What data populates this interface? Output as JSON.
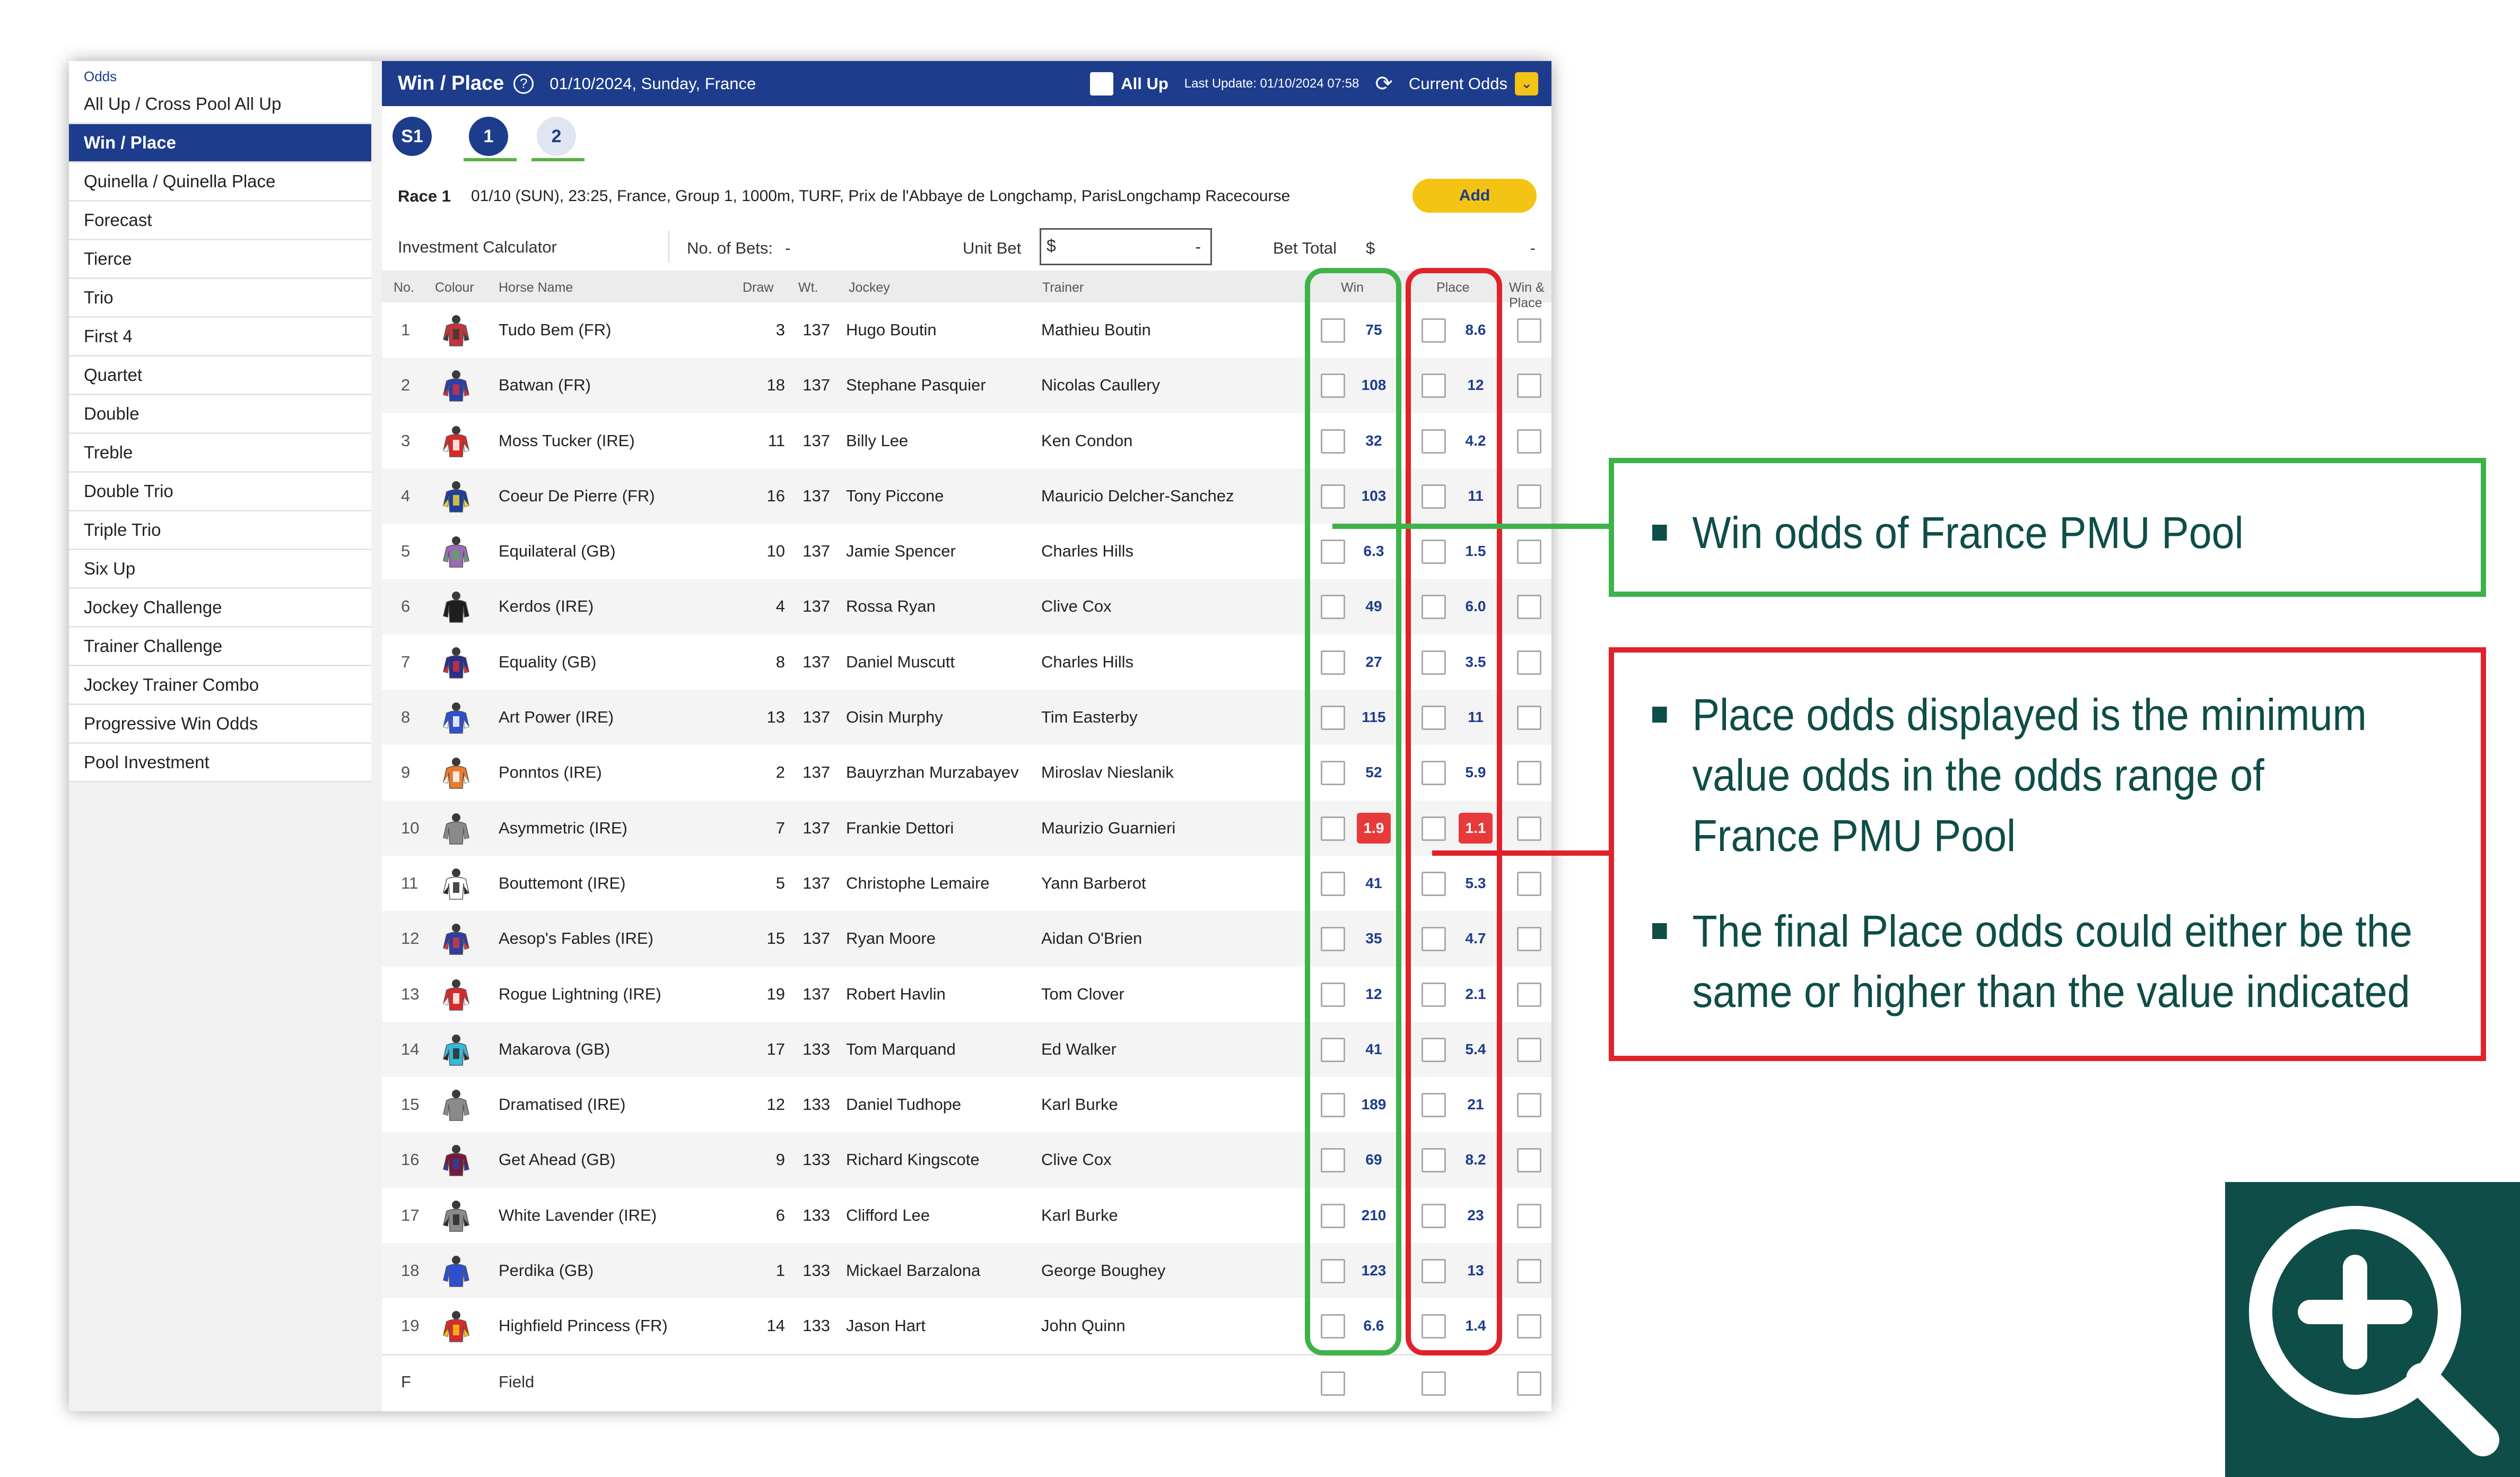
{
  "sidebar": {
    "header": "Odds",
    "items": [
      {
        "label": "All Up / Cross Pool All Up"
      },
      {
        "label": "Win / Place"
      },
      {
        "label": "Quinella / Quinella Place"
      },
      {
        "label": "Forecast"
      },
      {
        "label": "Tierce"
      },
      {
        "label": "Trio"
      },
      {
        "label": "First 4"
      },
      {
        "label": "Quartet"
      },
      {
        "label": "Double"
      },
      {
        "label": "Treble"
      },
      {
        "label": "Double Trio"
      },
      {
        "label": "Triple Trio"
      },
      {
        "label": "Six Up"
      },
      {
        "label": "Jockey Challenge"
      },
      {
        "label": "Trainer Challenge"
      },
      {
        "label": "Jockey Trainer Combo"
      },
      {
        "label": "Progressive Win Odds"
      },
      {
        "label": "Pool Investment"
      }
    ]
  },
  "topbar": {
    "title": "Win / Place",
    "help_icon": "?",
    "meeting": "01/10/2024, Sunday, France",
    "all_up": "All Up",
    "last_update": "Last Update: 01/10/2024 07:58",
    "refresh_icon": "⟳",
    "odds_type": "Current Odds",
    "chevron": "⌄"
  },
  "race_tabs": [
    "S1",
    "1",
    "2"
  ],
  "race": {
    "label": "Race 1",
    "description": "01/10 (SUN), 23:25, France, Group 1, 1000m, TURF, Prix de l'Abbaye de Longchamp, ParisLongchamp Racecourse",
    "add_label": "Add"
  },
  "calculator": {
    "title": "Investment Calculator",
    "no_of_bets_label": "No. of Bets:",
    "no_of_bets_value": "-",
    "unit_bet_label": "Unit Bet",
    "unit_bet_prefix": "$",
    "unit_bet_value": "-",
    "bet_total_label": "Bet Total",
    "bet_total_prefix": "$",
    "bet_total_value": "-"
  },
  "columns": {
    "no": "No.",
    "colour": "Colour",
    "horse": "Horse Name",
    "draw": "Draw",
    "wt": "Wt.",
    "jockey": "Jockey",
    "trainer": "Trainer",
    "win": "Win",
    "place": "Place",
    "win_place": "Win & Place"
  },
  "runners": [
    {
      "no": "1",
      "horse": "Tudo Bem (FR)",
      "draw": "3",
      "wt": "137",
      "jockey": "Hugo Boutin",
      "trainer": "Mathieu Boutin",
      "win": "75",
      "place": "8.6",
      "silk": [
        "#c7333a",
        "#3a3a3a"
      ]
    },
    {
      "no": "2",
      "horse": "Batwan (FR)",
      "draw": "18",
      "wt": "137",
      "jockey": "Stephane Pasquier",
      "trainer": "Nicolas Caullery",
      "win": "108",
      "place": "12",
      "silk": [
        "#2b3fa8",
        "#d0303a"
      ]
    },
    {
      "no": "3",
      "horse": "Moss Tucker (IRE)",
      "draw": "11",
      "wt": "137",
      "jockey": "Billy Lee",
      "trainer": "Ken Condon",
      "win": "32",
      "place": "4.2",
      "silk": [
        "#d92a2a",
        "#ffffff"
      ]
    },
    {
      "no": "4",
      "horse": "Coeur De Pierre (FR)",
      "draw": "16",
      "wt": "137",
      "jockey": "Tony Piccone",
      "trainer": "Mauricio Delcher-Sanchez",
      "win": "103",
      "place": "11",
      "silk": [
        "#1e3f9a",
        "#e6d43a"
      ]
    },
    {
      "no": "5",
      "horse": "Equilateral (GB)",
      "draw": "10",
      "wt": "137",
      "jockey": "Jamie Spencer",
      "trainer": "Charles Hills",
      "win": "6.3",
      "place": "1.5",
      "silk": [
        "#9a6ab8",
        "#5ea35a"
      ]
    },
    {
      "no": "6",
      "horse": "Kerdos (IRE)",
      "draw": "4",
      "wt": "137",
      "jockey": "Rossa Ryan",
      "trainer": "Clive Cox",
      "win": "49",
      "place": "6.0",
      "silk": [
        "#1e1e1e",
        "#1e1e1e"
      ]
    },
    {
      "no": "7",
      "horse": "Equality (GB)",
      "draw": "8",
      "wt": "137",
      "jockey": "Daniel Muscutt",
      "trainer": "Charles Hills",
      "win": "27",
      "place": "3.5",
      "silk": [
        "#2a2f8a",
        "#d22f3a"
      ]
    },
    {
      "no": "8",
      "horse": "Art Power (IRE)",
      "draw": "13",
      "wt": "137",
      "jockey": "Oisin Murphy",
      "trainer": "Tim Easterby",
      "win": "115",
      "place": "11",
      "silk": [
        "#2d4fd0",
        "#ffffff"
      ]
    },
    {
      "no": "9",
      "horse": "Ponntos (IRE)",
      "draw": "2",
      "wt": "137",
      "jockey": "Bauyrzhan Murzabayev",
      "trainer": "Miroslav Nieslanik",
      "win": "52",
      "place": "5.9",
      "silk": [
        "#e97b2c",
        "#ffffff"
      ]
    },
    {
      "no": "10",
      "horse": "Asymmetric (IRE)",
      "draw": "7",
      "wt": "137",
      "jockey": "Frankie Dettori",
      "trainer": "Maurizio Guarnieri",
      "win": "1.9",
      "place": "1.1",
      "win_hot": true,
      "place_hot": true,
      "silk": [
        "#8a8a8a",
        "#8a8a8a"
      ]
    },
    {
      "no": "11",
      "horse": "Bouttemont (IRE)",
      "draw": "5",
      "wt": "137",
      "jockey": "Christophe Lemaire",
      "trainer": "Yann Barberot",
      "win": "41",
      "place": "5.3",
      "silk": [
        "#ffffff",
        "#2a2a2a"
      ]
    },
    {
      "no": "12",
      "horse": "Aesop's Fables (IRE)",
      "draw": "15",
      "wt": "137",
      "jockey": "Ryan Moore",
      "trainer": "Aidan O'Brien",
      "win": "35",
      "place": "4.7",
      "silk": [
        "#2d3fa0",
        "#d23a3a"
      ]
    },
    {
      "no": "13",
      "horse": "Rogue Lightning (IRE)",
      "draw": "19",
      "wt": "137",
      "jockey": "Robert Havlin",
      "trainer": "Tom Clover",
      "win": "12",
      "place": "2.1",
      "silk": [
        "#d92a2a",
        "#ffffff"
      ]
    },
    {
      "no": "14",
      "horse": "Makarova (GB)",
      "draw": "17",
      "wt": "133",
      "jockey": "Tom Marquand",
      "trainer": "Ed Walker",
      "win": "41",
      "place": "5.4",
      "silk": [
        "#36b9d8",
        "#2a2a2a"
      ]
    },
    {
      "no": "15",
      "horse": "Dramatised (IRE)",
      "draw": "12",
      "wt": "133",
      "jockey": "Daniel Tudhope",
      "trainer": "Karl Burke",
      "win": "189",
      "place": "21",
      "silk": [
        "#8a8a8a",
        "#8a8a8a"
      ]
    },
    {
      "no": "16",
      "horse": "Get Ahead (GB)",
      "draw": "9",
      "wt": "133",
      "jockey": "Richard Kingscote",
      "trainer": "Clive Cox",
      "win": "69",
      "place": "8.2",
      "silk": [
        "#7a1a3a",
        "#2d3fa0"
      ]
    },
    {
      "no": "17",
      "horse": "White Lavender (IRE)",
      "draw": "6",
      "wt": "133",
      "jockey": "Clifford Lee",
      "trainer": "Karl Burke",
      "win": "210",
      "place": "23",
      "silk": [
        "#8a8a8a",
        "#2a2a2a"
      ]
    },
    {
      "no": "18",
      "horse": "Perdika (GB)",
      "draw": "1",
      "wt": "133",
      "jockey": "Mickael Barzalona",
      "trainer": "George Boughey",
      "win": "123",
      "place": "13",
      "silk": [
        "#2d4fd0",
        "#2d4fd0"
      ]
    },
    {
      "no": "19",
      "horse": "Highfield Princess (FR)",
      "draw": "14",
      "wt": "133",
      "jockey": "Jason Hart",
      "trainer": "John Quinn",
      "win": "6.6",
      "place": "1.4",
      "silk": [
        "#d92a2a",
        "#f4c414"
      ]
    }
  ],
  "field_row": {
    "no": "F",
    "label": "Field"
  },
  "callouts": {
    "win": [
      "Win odds of France PMU Pool"
    ],
    "place": [
      [
        "Place odds displayed is the minimum",
        "value odds in the odds range of",
        "France PMU Pool"
      ],
      [
        "The final Place odds could either be the",
        "same or higher than the value indicated"
      ]
    ]
  },
  "colors": {
    "navy": "#1d3c8c",
    "win_highlight": "#3fb24a",
    "place_highlight": "#e0222a",
    "hot_odds": "#e8393b",
    "callout_text": "#0e4d48",
    "add_button": "#f4c414"
  },
  "icons": {
    "zoom": "zoom-in-magnifier-icon"
  }
}
